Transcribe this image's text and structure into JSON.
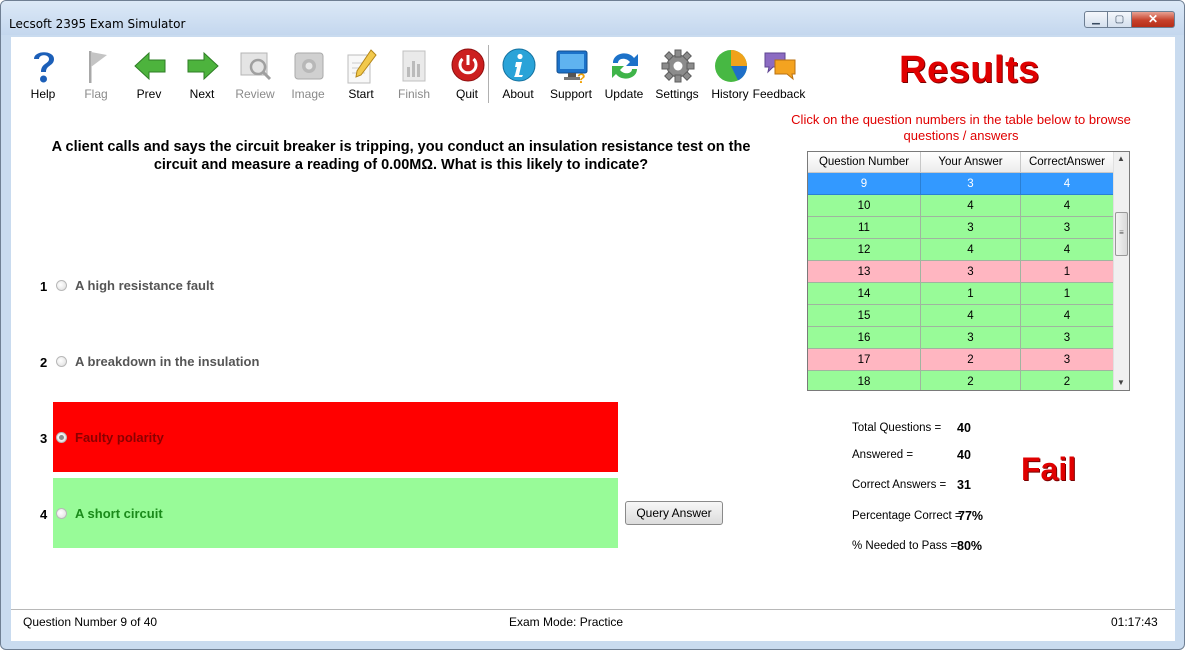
{
  "window": {
    "title": "Lecsoft 2395 Exam Simulator"
  },
  "toolbar": {
    "items": [
      {
        "label": "Help",
        "icon": "help-icon",
        "enabled": true
      },
      {
        "label": "Flag",
        "icon": "flag-icon",
        "enabled": false
      },
      {
        "label": "Prev",
        "icon": "arrow-left-icon",
        "enabled": true
      },
      {
        "label": "Next",
        "icon": "arrow-right-icon",
        "enabled": true
      },
      {
        "label": "Review",
        "icon": "review-magnifier-icon",
        "enabled": false
      },
      {
        "label": "Image",
        "icon": "image-icon",
        "enabled": false
      },
      {
        "label": "Start",
        "icon": "start-pencil-icon",
        "enabled": true
      },
      {
        "label": "Finish",
        "icon": "finish-document-icon",
        "enabled": false
      },
      {
        "label": "Quit",
        "icon": "power-icon",
        "enabled": true
      },
      {
        "label": "About",
        "icon": "info-icon",
        "enabled": true
      },
      {
        "label": "Support",
        "icon": "support-monitor-icon",
        "enabled": true
      },
      {
        "label": "Update",
        "icon": "update-arrows-icon",
        "enabled": true
      },
      {
        "label": "Settings",
        "icon": "gear-icon",
        "enabled": true
      },
      {
        "label": "History",
        "icon": "pie-chart-icon",
        "enabled": true
      },
      {
        "label": "Feedback",
        "icon": "speech-bubbles-icon",
        "enabled": true
      }
    ]
  },
  "results": {
    "title": "Results",
    "instruction": "Click on the question numbers in the table below to browse questions / answers"
  },
  "question": {
    "text": "A client calls and says the circuit breaker is tripping, you conduct an insulation resistance test on the circuit and measure a reading of 0.00MΩ. What is this likely to indicate?",
    "answers": [
      {
        "number": "1",
        "text": "A high resistance fault"
      },
      {
        "number": "2",
        "text": "A breakdown in the insulation"
      },
      {
        "number": "3",
        "text": "Faulty polarity"
      },
      {
        "number": "4",
        "text": "A  short circuit"
      }
    ],
    "query_button": "Query Answer"
  },
  "table": {
    "headers": [
      "Question Number",
      "Your Answer",
      "CorrectAnswer"
    ],
    "rows": [
      {
        "q": "9",
        "yours": "3",
        "correct": "4"
      },
      {
        "q": "10",
        "yours": "4",
        "correct": "4"
      },
      {
        "q": "11",
        "yours": "3",
        "correct": "3"
      },
      {
        "q": "12",
        "yours": "4",
        "correct": "4"
      },
      {
        "q": "13",
        "yours": "3",
        "correct": "1"
      },
      {
        "q": "14",
        "yours": "1",
        "correct": "1"
      },
      {
        "q": "15",
        "yours": "4",
        "correct": "4"
      },
      {
        "q": "16",
        "yours": "3",
        "correct": "3"
      },
      {
        "q": "17",
        "yours": "2",
        "correct": "3"
      },
      {
        "q": "18",
        "yours": "2",
        "correct": "2"
      }
    ]
  },
  "stats": {
    "total_label": "Total Questions =",
    "total": "40",
    "answered_label": "Answered =",
    "answered": "40",
    "correct_label": "Correct Answers =",
    "correct": "31",
    "pct_label": "Percentage Correct =",
    "pct": "77%",
    "pass_label": "% Needed to Pass =",
    "pass": "80%",
    "verdict": "Fail"
  },
  "status": {
    "left": "Question Number 9 of 40",
    "center": "Exam Mode: Practice",
    "right": "01:17:43"
  },
  "colors": {
    "correct": "#98fb98",
    "wrong_row": "#ffb6c1",
    "selected_row": "#3399ff",
    "wrong_answer": "#ff0000",
    "accent": "#e00000"
  }
}
